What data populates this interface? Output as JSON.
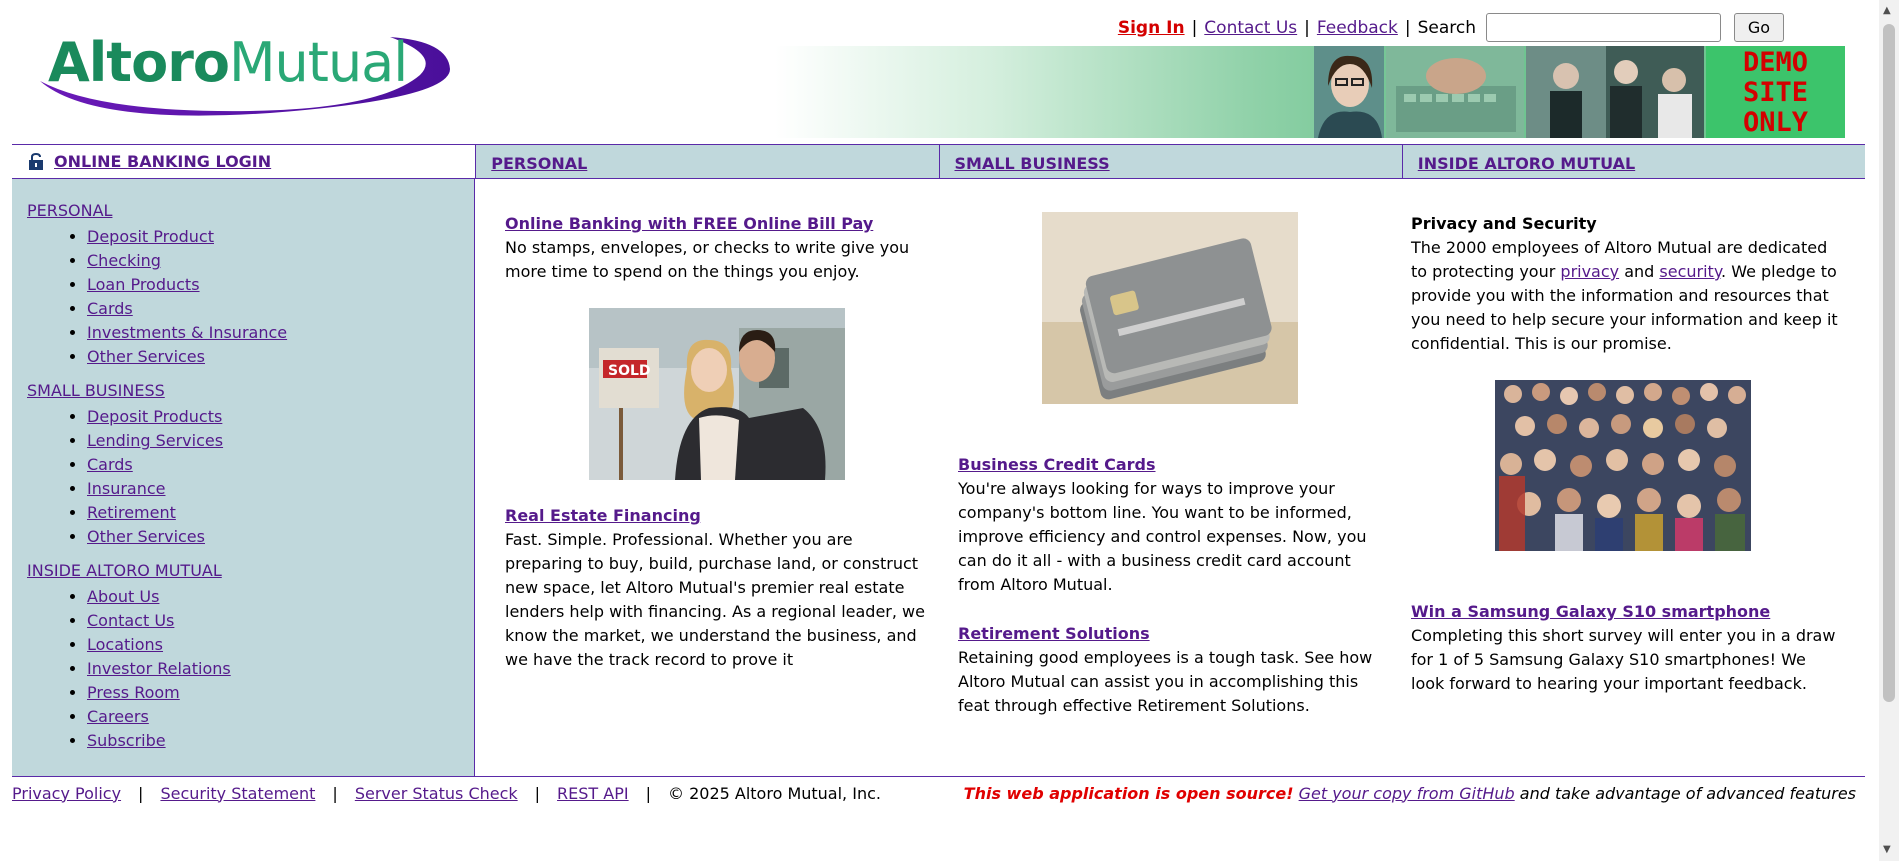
{
  "header": {
    "signin": "Sign In",
    "contact": "Contact Us",
    "feedback": "Feedback",
    "search_label": "Search",
    "search_value": "",
    "go": "Go",
    "logo_left": "Altoro",
    "logo_right": "Mutual",
    "banner_demo": [
      "DEMO",
      "SITE",
      "ONLY"
    ]
  },
  "nav": {
    "login": "ONLINE BANKING LOGIN",
    "personal": "PERSONAL",
    "small_business": "SMALL BUSINESS",
    "inside": "INSIDE ALTORO MUTUAL"
  },
  "sidebar": {
    "sections": [
      {
        "title": "PERSONAL",
        "items": [
          "Deposit Product",
          "Checking",
          "Loan Products",
          "Cards",
          "Investments & Insurance",
          "Other Services"
        ]
      },
      {
        "title": "SMALL BUSINESS",
        "items": [
          "Deposit Products",
          "Lending Services",
          "Cards",
          "Insurance",
          "Retirement",
          "Other Services"
        ]
      },
      {
        "title": "INSIDE ALTORO MUTUAL",
        "items": [
          "About Us",
          "Contact Us",
          "Locations",
          "Investor Relations",
          "Press Room",
          "Careers",
          "Subscribe"
        ]
      }
    ]
  },
  "main": {
    "col1": {
      "t1": "Online Banking with FREE Online Bill Pay",
      "p1": "No stamps, envelopes, or checks to write give you more time to spend on the things you enjoy.",
      "t2": "Real Estate Financing",
      "p2": "Fast. Simple. Professional. Whether you are preparing to buy, build, purchase land, or construct new space, let Altoro Mutual's premier real estate lenders help with financing. As a regional leader, we know the market, we understand the business, and we have the track record to prove it",
      "sign": "SOLD"
    },
    "col2": {
      "t1": "Business Credit Cards",
      "p1": "You're always looking for ways to improve your company's bottom line. You want to be informed, improve efficiency and control expenses. Now, you can do it all - with a business credit card account from Altoro Mutual.",
      "t2": "Retirement Solutions",
      "p2": "Retaining good employees is a tough task. See how Altoro Mutual can assist you in accomplishing this feat through effective Retirement Solutions."
    },
    "col3": {
      "t1": "Privacy and Security",
      "p1a": "The 2000 employees of Altoro Mutual are dedicated to protecting your ",
      "privacy": "privacy",
      "and": " and ",
      "security": "security",
      "p1b": ". We pledge to provide you with the information and resources that you need to help secure your information and keep it confidential. This is our promise.",
      "t2": "Win a Samsung Galaxy S10 smartphone",
      "p2": "Completing this short survey will enter you in a draw for 1 of 5 Samsung Galaxy S10 smartphones! We look forward to hearing your important feedback."
    }
  },
  "footer": {
    "privacy": "Privacy Policy",
    "security": "Security Statement",
    "status": "Server Status Check",
    "rest": "REST API",
    "copyright": "© 2025 Altoro Mutual, Inc.",
    "open_source": "This web application is open source!",
    "github": "Get your copy from GitHub",
    "tail": " and take advantage of advanced features",
    "sep": "|"
  },
  "colors": {
    "nav_bg": "#c0d8dc",
    "border": "#5a2aa8",
    "link": "#551a8b",
    "signin": "#d40000",
    "demo_bg": "#3cc46b"
  }
}
